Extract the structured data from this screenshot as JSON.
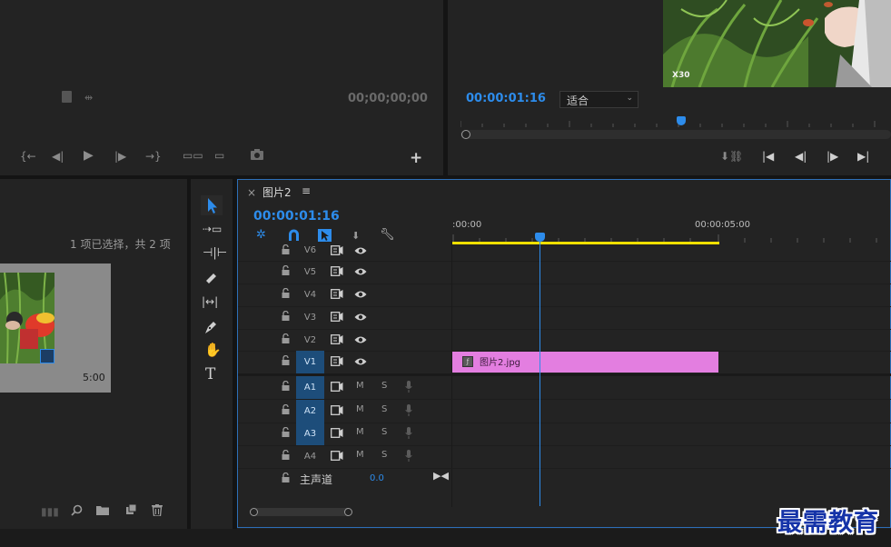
{
  "source_monitor": {
    "timecode": "00;00;00;00"
  },
  "program_monitor": {
    "timecode": "00:00:01:16",
    "fit_select": "适合",
    "preview_watermark": "X30"
  },
  "project": {
    "selection_status": "1 项已选择，共 2 项",
    "thumb_duration": "5:00"
  },
  "timeline": {
    "tab_title": "图片2",
    "close_label": "×",
    "menu_label": "≡",
    "timecode": "00:00:01:16",
    "ruler": {
      "start": ":00:00",
      "mark": "00:00:05:00"
    },
    "video_tracks": [
      {
        "name": "V6",
        "selected": false
      },
      {
        "name": "V5",
        "selected": false
      },
      {
        "name": "V4",
        "selected": false
      },
      {
        "name": "V3",
        "selected": false
      },
      {
        "name": "V2",
        "selected": false
      },
      {
        "name": "V1",
        "selected": true
      }
    ],
    "audio_tracks": [
      {
        "name": "A1",
        "m": "M",
        "s": "S"
      },
      {
        "name": "A2",
        "m": "M",
        "s": "S"
      },
      {
        "name": "A3",
        "m": "M",
        "s": "S"
      },
      {
        "name": "A4",
        "m": "M",
        "s": "S"
      }
    ],
    "master": {
      "label": "主声道",
      "value": "0.0"
    },
    "clip": {
      "name": "图片2.jpg",
      "color": "#e37ee0"
    }
  },
  "tools": [
    "selection-tool",
    "track-select-tool",
    "ripple-edit-tool",
    "razor-tool",
    "slip-tool",
    "pen-tool",
    "hand-tool",
    "type-tool"
  ],
  "watermark": "最需教育",
  "colors": {
    "accent": "#2d8ceb",
    "selected_track": "#1d4d7a",
    "work_area": "#f0e000",
    "clip": "#e37ee0",
    "watermark": "#1533a8"
  }
}
